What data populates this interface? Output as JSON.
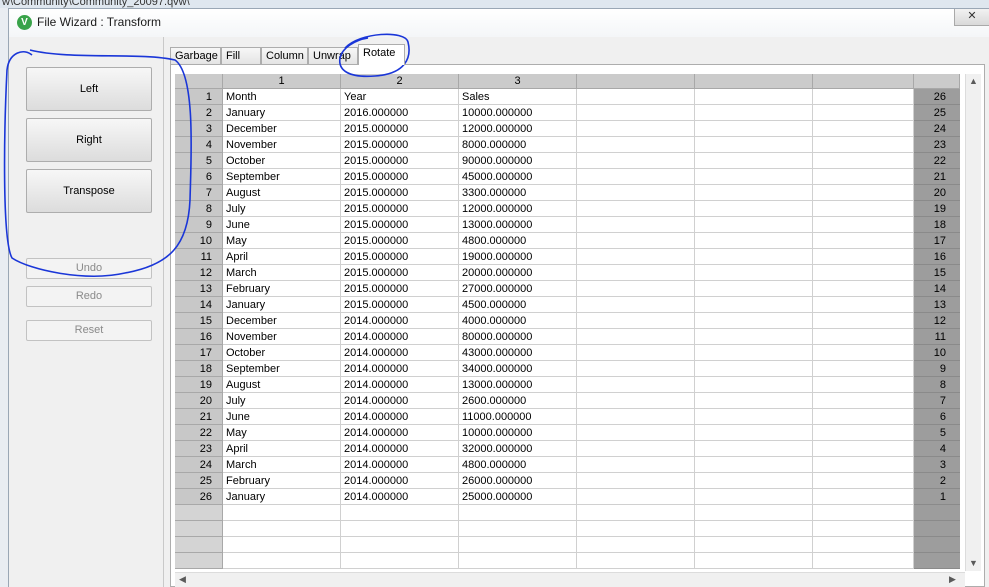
{
  "background_path": "w\\Community\\Community_20097.qvw\\",
  "window": {
    "title": "File Wizard : Transform",
    "app_icon": "V",
    "close_label": "✕"
  },
  "left_panel": {
    "left_label": "Left",
    "right_label": "Right",
    "transpose_label": "Transpose",
    "undo_label": "Undo",
    "redo_label": "Redo",
    "reset_label": "Reset"
  },
  "tabs": [
    "Garbage",
    "Fill",
    "Column",
    "Unwrap",
    "Rotate"
  ],
  "active_tab": "Rotate",
  "grid": {
    "columns": [
      "1",
      "2",
      "3",
      "",
      "",
      ""
    ],
    "rows": [
      [
        "Month",
        "Year",
        "Sales"
      ],
      [
        "January",
        "2016.000000",
        "10000.000000"
      ],
      [
        "December",
        "2015.000000",
        "12000.000000"
      ],
      [
        "November",
        "2015.000000",
        "8000.000000"
      ],
      [
        "October",
        "2015.000000",
        "90000.000000"
      ],
      [
        "September",
        "2015.000000",
        "45000.000000"
      ],
      [
        "August",
        "2015.000000",
        "3300.000000"
      ],
      [
        "July",
        "2015.000000",
        "12000.000000"
      ],
      [
        "June",
        "2015.000000",
        "13000.000000"
      ],
      [
        "May",
        "2015.000000",
        "4800.000000"
      ],
      [
        "April",
        "2015.000000",
        "19000.000000"
      ],
      [
        "March",
        "2015.000000",
        "20000.000000"
      ],
      [
        "February",
        "2015.000000",
        "27000.000000"
      ],
      [
        "January",
        "2015.000000",
        "4500.000000"
      ],
      [
        "December",
        "2014.000000",
        "4000.000000"
      ],
      [
        "November",
        "2014.000000",
        "80000.000000"
      ],
      [
        "October",
        "2014.000000",
        "43000.000000"
      ],
      [
        "September",
        "2014.000000",
        "34000.000000"
      ],
      [
        "August",
        "2014.000000",
        "13000.000000"
      ],
      [
        "July",
        "2014.000000",
        "2600.000000"
      ],
      [
        "June",
        "2014.000000",
        "11000.000000"
      ],
      [
        "May",
        "2014.000000",
        "10000.000000"
      ],
      [
        "April",
        "2014.000000",
        "32000.000000"
      ],
      [
        "March",
        "2014.000000",
        "4800.000000"
      ],
      [
        "February",
        "2014.000000",
        "26000.000000"
      ],
      [
        "January",
        "2014.000000",
        "25000.000000"
      ]
    ],
    "empty_row_count": 4
  },
  "colors": {
    "annotation": "#1a36d8"
  }
}
